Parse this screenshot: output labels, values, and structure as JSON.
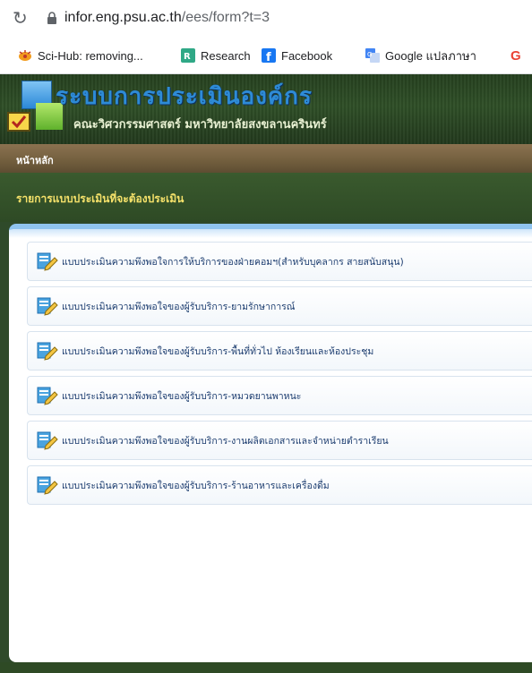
{
  "browser": {
    "url_host": "infor.eng.psu.ac.th",
    "url_path": "/ees/form?t=3",
    "bookmarks": [
      {
        "label": "Sci-Hub: removing...",
        "icon": "scihub-icon"
      },
      {
        "label": "Research",
        "icon": "researchgate-icon"
      },
      {
        "label": "Facebook",
        "icon": "facebook-icon"
      },
      {
        "label": "Google แปลภาษา",
        "icon": "google-translate-icon"
      },
      {
        "label": "G",
        "icon": "google-icon"
      }
    ]
  },
  "site": {
    "title": "ระบบการประเมินองค์กร",
    "subtitle": "คณะวิศวกรรมศาสตร์ มหาวิทยาลัยสงขลานครินทร์"
  },
  "nav": {
    "home": "หน้าหลัก"
  },
  "section": {
    "title": "รายการแบบประเมินที่จะต้องประเมิน"
  },
  "forms": [
    {
      "label": "แบบประเมินความพึงพอใจการให้บริการของฝ่ายคอมฯ(สำหรับบุคลากร สายสนับสนุน)"
    },
    {
      "label": "แบบประเมินความพึงพอใจของผู้รับบริการ-ยามรักษาการณ์"
    },
    {
      "label": "แบบประเมินความพึงพอใจของผู้รับบริการ-พื้นที่ทั่วไป ห้องเรียนและห้องประชุม"
    },
    {
      "label": "แบบประเมินความพึงพอใจของผู้รับบริการ-หมวดยานพาหนะ"
    },
    {
      "label": "แบบประเมินความพึงพอใจของผู้รับบริการ-งานผลิตเอกสารและจำหน่ายตำราเรียน"
    },
    {
      "label": "แบบประเมินความพึงพอใจของผู้รับบริการ-ร้านอาหารและเครื่องดื่ม"
    }
  ],
  "colors": {
    "header_green": "#2f4f27",
    "nav_brown": "#74603f",
    "section_title": "#f5e16a",
    "link_text": "#1a3b6e",
    "panel_border": "#8fc4ef"
  }
}
